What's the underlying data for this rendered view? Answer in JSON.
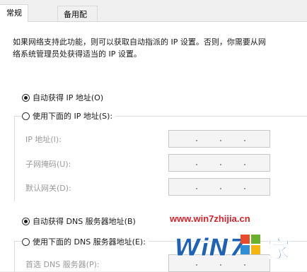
{
  "tabs": [
    {
      "label": "常规",
      "active": true
    },
    {
      "label": "备用配置",
      "active": false
    }
  ],
  "description": [
    "如果网络支持此功能，则可以获取自动指派的 IP 设置。否则，你需要从网",
    "络系统管理员处获得适当的 IP 设置。"
  ],
  "ip_section": {
    "auto_option": {
      "label": "自动获得 IP 地址(O)",
      "checked": true
    },
    "manual_option": {
      "label": "使用下面的 IP 地址(S):",
      "checked": false
    },
    "fields": [
      {
        "label": "IP 地址(I):",
        "value": ". . ."
      },
      {
        "label": "子网掩码(U):",
        "value": ". . ."
      },
      {
        "label": "默认网关(D):",
        "value": ". . ."
      }
    ]
  },
  "dns_section": {
    "auto_option": {
      "label": "自动获得 DNS 服务器地址(B)",
      "checked": true
    },
    "manual_option": {
      "label": "使用下面的 DNS 服务器地址(E):",
      "checked": false
    },
    "fields": [
      {
        "label": "首选 DNS 服务器(P):",
        "value": ". . ."
      }
    ]
  },
  "watermark": {
    "url": "www.win7zhijia.cn",
    "brand_latin": "WiN7",
    "brand_cn": "家",
    "colors": {
      "red": "#d8232a",
      "blue": "#1d62b7"
    }
  }
}
